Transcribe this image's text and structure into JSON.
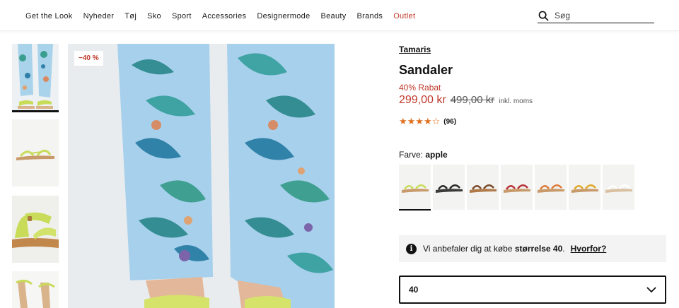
{
  "nav": {
    "items": [
      "Get the Look",
      "Nyheder",
      "Tøj",
      "Sko",
      "Sport",
      "Accessories",
      "Designermode",
      "Beauty",
      "Brands",
      "Outlet"
    ],
    "outlet_color": "#c0392b"
  },
  "search": {
    "placeholder": "Søg",
    "icon": "search-icon"
  },
  "badge": {
    "text": "−40 %"
  },
  "product": {
    "brand": "Tamaris",
    "title": "Sandaler",
    "discount_label": "40% Rabat",
    "price": "299,00 kr",
    "old_price": "499,00 kr",
    "vat": "inkl. moms",
    "rating_count": "(96)",
    "stars": "★★★★☆",
    "rating": 4
  },
  "color": {
    "label": "Farve:",
    "value": "apple"
  },
  "swatches": [
    "apple",
    "black",
    "brown",
    "red",
    "orange",
    "yellow",
    "white"
  ],
  "size_hint": {
    "text_pre": "Vi anbefaler dig at købe ",
    "size_text": "størrelse 40",
    "text_post": ".",
    "link": "Hvorfor?"
  },
  "size_select": {
    "value": "40"
  },
  "colors": {
    "sale_red": "#c0392b",
    "star_orange": "#e07020",
    "sandal_green": "#c8dc5a"
  }
}
